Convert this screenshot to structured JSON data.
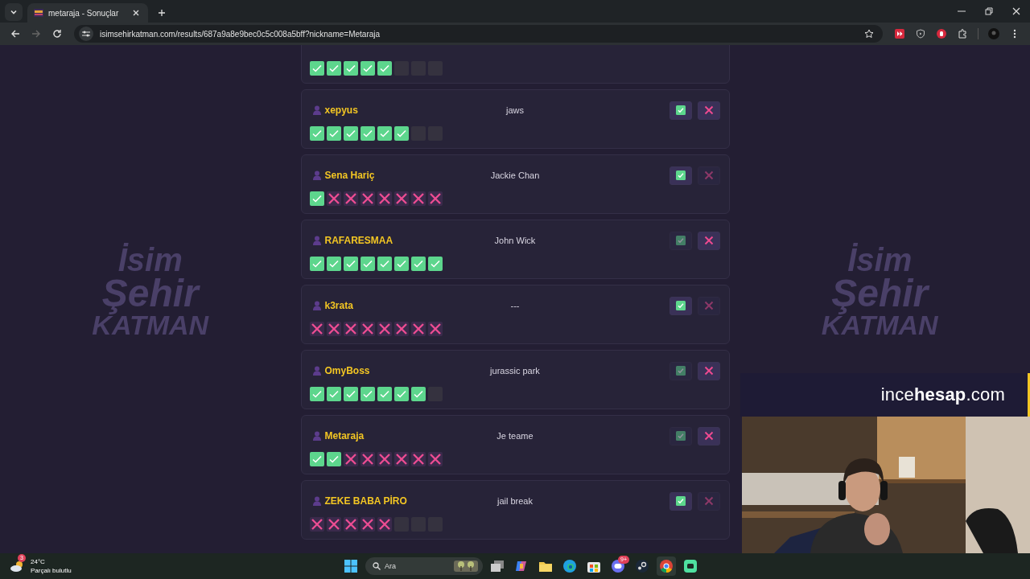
{
  "browser": {
    "tab": {
      "title": "metaraja - Sonuçlar",
      "selected": true
    },
    "url": "isimsehirkatman.com/results/687a9a8e9bec0c5c008a5bff?nickname=Metaraja"
  },
  "background_logos": [
    {
      "lines": [
        "İsim",
        "Şehir",
        "KATMAN"
      ]
    },
    {
      "lines": [
        "İsim",
        "Şehir",
        "KATMAN"
      ]
    }
  ],
  "results": [
    {
      "marks": [
        {
          "kind": "correct"
        },
        {
          "kind": "correct"
        },
        {
          "kind": "correct"
        },
        {
          "kind": "correct"
        },
        {
          "kind": "correct"
        },
        {
          "kind": "empty"
        },
        {
          "kind": "empty"
        },
        {
          "kind": "empty"
        }
      ]
    },
    {
      "name": "xepyus",
      "answer": "jaws",
      "approve_active": true,
      "reject_active": true,
      "marks": [
        {
          "kind": "correct"
        },
        {
          "kind": "correct"
        },
        {
          "kind": "correct"
        },
        {
          "kind": "correct"
        },
        {
          "kind": "correct"
        },
        {
          "kind": "correct"
        },
        {
          "kind": "empty"
        },
        {
          "kind": "empty"
        }
      ]
    },
    {
      "name": "Sena Hariç",
      "answer": "Jackie Chan",
      "approve_active": true,
      "reject_active": false,
      "marks": [
        {
          "kind": "correct"
        },
        {
          "kind": "wrong"
        },
        {
          "kind": "wrong"
        },
        {
          "kind": "wrong"
        },
        {
          "kind": "wrong"
        },
        {
          "kind": "wrong"
        },
        {
          "kind": "wrong"
        },
        {
          "kind": "wrong"
        }
      ]
    },
    {
      "name": "RAFARESMAA",
      "answer": "John Wick",
      "approve_active": false,
      "reject_active": true,
      "marks": [
        {
          "kind": "correct"
        },
        {
          "kind": "correct"
        },
        {
          "kind": "correct"
        },
        {
          "kind": "correct"
        },
        {
          "kind": "correct"
        },
        {
          "kind": "correct"
        },
        {
          "kind": "correct"
        },
        {
          "kind": "correct"
        }
      ]
    },
    {
      "name": "k3rata",
      "answer": "---",
      "approve_active": true,
      "reject_active": false,
      "marks": [
        {
          "kind": "wrong"
        },
        {
          "kind": "wrong"
        },
        {
          "kind": "wrong"
        },
        {
          "kind": "wrong"
        },
        {
          "kind": "wrong"
        },
        {
          "kind": "wrong"
        },
        {
          "kind": "wrong"
        },
        {
          "kind": "wrong"
        }
      ]
    },
    {
      "name": "OmyBoss",
      "answer": "jurassic park",
      "approve_active": false,
      "reject_active": true,
      "marks": [
        {
          "kind": "correct"
        },
        {
          "kind": "correct"
        },
        {
          "kind": "correct"
        },
        {
          "kind": "correct"
        },
        {
          "kind": "correct"
        },
        {
          "kind": "correct"
        },
        {
          "kind": "correct"
        },
        {
          "kind": "empty"
        }
      ]
    },
    {
      "name": "Metaraja",
      "answer": "Je teame",
      "approve_active": false,
      "reject_active": true,
      "marks": [
        {
          "kind": "correct"
        },
        {
          "kind": "correct"
        },
        {
          "kind": "wrong"
        },
        {
          "kind": "wrong"
        },
        {
          "kind": "wrong"
        },
        {
          "kind": "wrong"
        },
        {
          "kind": "wrong"
        },
        {
          "kind": "wrong"
        }
      ]
    },
    {
      "name": "ZEKE BABA PİRO",
      "answer": "jail break",
      "approve_active": true,
      "reject_active": false,
      "marks": [
        {
          "kind": "wrong"
        },
        {
          "kind": "wrong"
        },
        {
          "kind": "wrong"
        },
        {
          "kind": "wrong"
        },
        {
          "kind": "wrong"
        },
        {
          "kind": "empty"
        },
        {
          "kind": "empty"
        },
        {
          "kind": "empty"
        }
      ]
    }
  ],
  "sponsor": {
    "text": "ince**hesap**.com"
  },
  "taskbar": {
    "weather": {
      "badge": "3",
      "temperature": "24°C",
      "condition": "Parçalı bulutlu"
    },
    "search": {
      "placeholder": "Ara"
    },
    "chat_badge": "9+"
  }
}
